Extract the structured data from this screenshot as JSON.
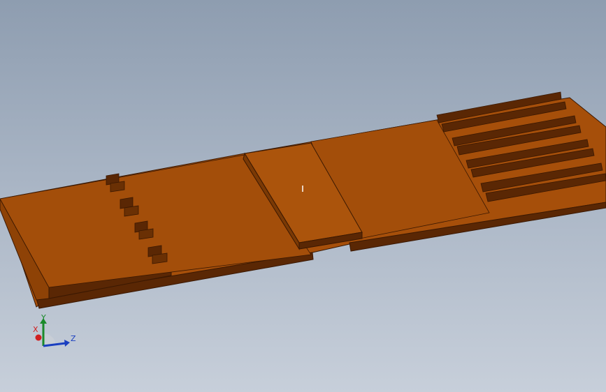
{
  "viewport": {
    "background_top": "#8e9db0",
    "background_bottom": "#c7cfda"
  },
  "model": {
    "face_color": "#a34d08",
    "top_color": "#a84f0a",
    "side_color": "#5c2804",
    "edge_color": "#3a1802"
  },
  "triad": {
    "x_label": "X",
    "y_label": "Y",
    "z_label": "Z",
    "x_color": "#d02020",
    "y_color": "#1a8a2a",
    "z_color": "#1a3fc0"
  }
}
